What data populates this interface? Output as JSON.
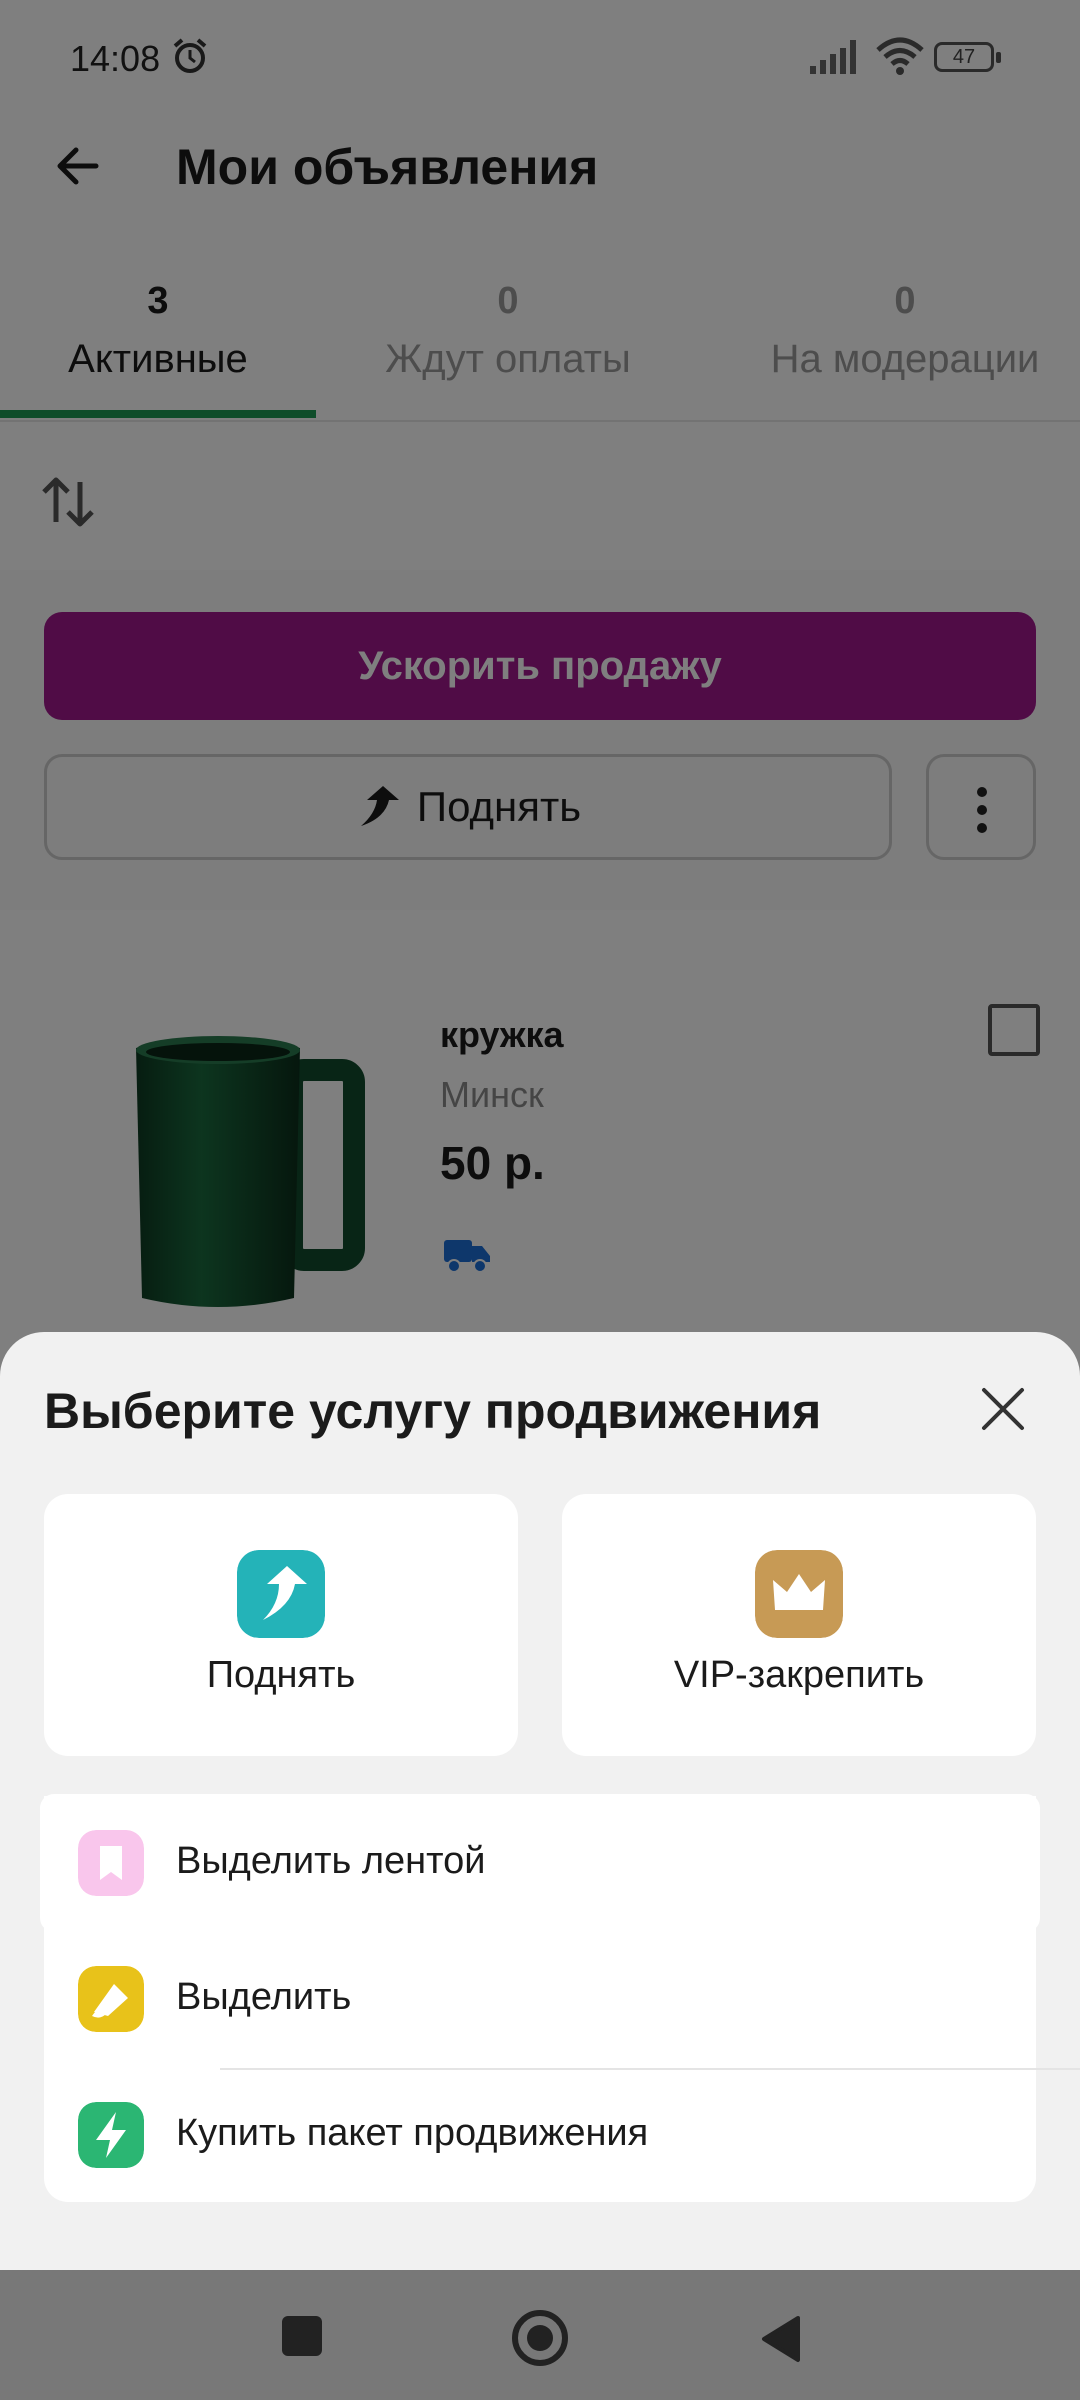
{
  "status_bar": {
    "time": "14:08",
    "battery": "47"
  },
  "header": {
    "title": "Мои объявления"
  },
  "tabs": [
    {
      "count": "3",
      "label": "Активные"
    },
    {
      "count": "0",
      "label": "Ждут оплаты"
    },
    {
      "count": "0",
      "label": "На модерации"
    }
  ],
  "actions": {
    "accelerate_label": "Ускорить продажу",
    "raise_label": "Поднять"
  },
  "listing": {
    "title": "кружка",
    "city": "Минск",
    "price": "50 р."
  },
  "sheet": {
    "title": "Выберите услугу продвижения",
    "tiles": [
      {
        "label": "Поднять",
        "icon": "raise-arrow-icon",
        "color": "#24b3b8"
      },
      {
        "label": "VIP-закрепить",
        "icon": "crown-icon",
        "color": "#c79a55"
      }
    ],
    "options": [
      {
        "label": "Выделить лентой",
        "icon": "bookmark-icon",
        "color": "#f9c6ec"
      },
      {
        "label": "Выделить",
        "icon": "paint-icon",
        "color": "#e8c21a"
      },
      {
        "label": "Купить пакет продвижения",
        "icon": "lightning-icon",
        "color": "#2bb673"
      }
    ]
  },
  "colors": {
    "accent_green": "#1f9a55",
    "accent_purple": "#a0198c"
  }
}
